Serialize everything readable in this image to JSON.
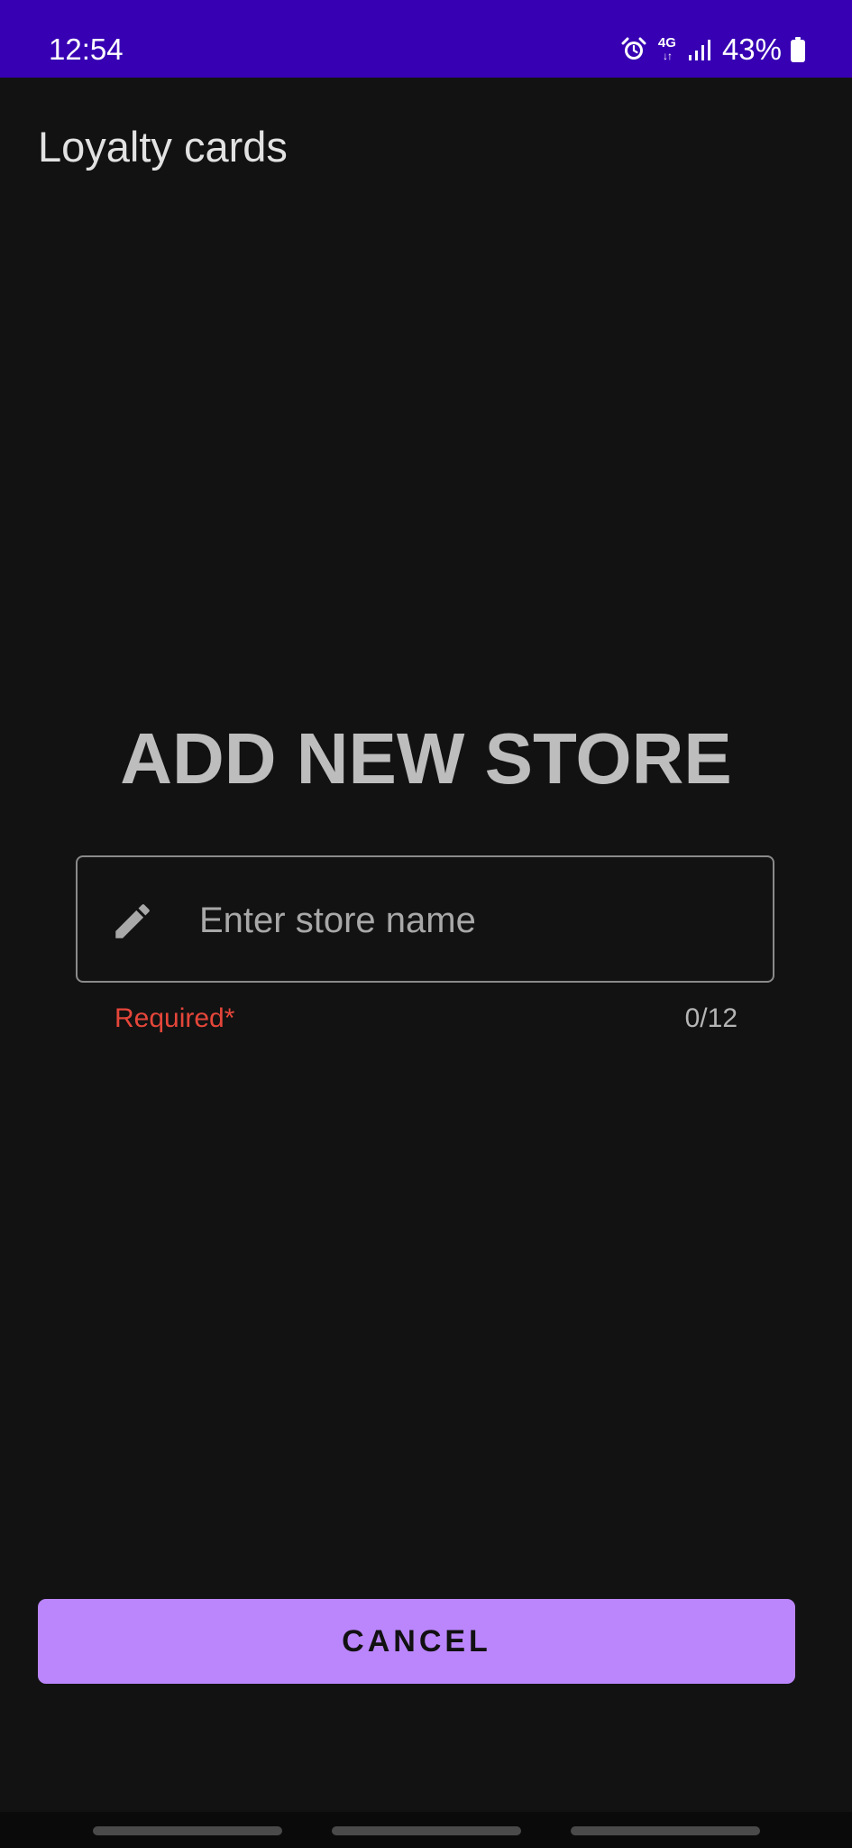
{
  "status_bar": {
    "time": "12:54",
    "network_type": "4G",
    "network_arrows": "↓↑",
    "battery_percent": "43%",
    "icons": [
      "alarm-icon",
      "signal-icon",
      "battery-icon"
    ],
    "background_color": "#3700B3"
  },
  "app_bar": {
    "title": "Loyalty cards"
  },
  "main": {
    "heading": "ADD NEW STORE",
    "store_field": {
      "placeholder": "Enter store name",
      "value": "",
      "icon": "pencil-icon",
      "helper_text": "Required*",
      "counter": "0/12",
      "error_color": "#e5463a"
    }
  },
  "actions": {
    "cancel_label": "CANCEL",
    "button_color": "#BB86FC"
  },
  "nav_bar": {
    "items": [
      "recent-apps",
      "home",
      "back"
    ]
  },
  "theme": {
    "background": "#121212",
    "accent": "#BB86FC"
  }
}
